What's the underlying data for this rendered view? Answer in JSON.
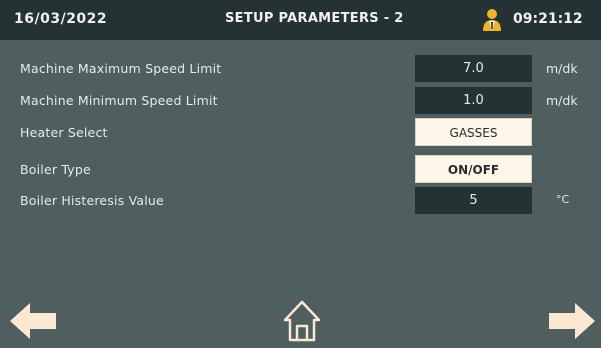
{
  "header": {
    "date": "16/03/2022",
    "title": "SETUP PARAMETERS - 2",
    "time": "09:21:12",
    "user_icon": "user-icon"
  },
  "parameters": [
    {
      "label": "Machine Maximum Speed Limit",
      "value": "7.0",
      "unit": "m/dk"
    },
    {
      "label": "Machine Minimum Speed Limit",
      "value": "1.0",
      "unit": "m/dk"
    },
    {
      "label": "Heater Select",
      "value": "GASSES"
    },
    {
      "label": "Boiler Type",
      "value": "ON/OFF"
    },
    {
      "label": "Boiler Histeresis Value",
      "value": "5",
      "unit": "°C"
    }
  ],
  "nav": {
    "back_icon": "arrow-left-icon",
    "home_icon": "home-icon",
    "next_icon": "arrow-right-icon"
  },
  "colors": {
    "background": "#4f5e5e",
    "header": "#243233",
    "value_box": "#243233",
    "select_button": "#fff6ea",
    "arrow": "#fce8d2"
  }
}
